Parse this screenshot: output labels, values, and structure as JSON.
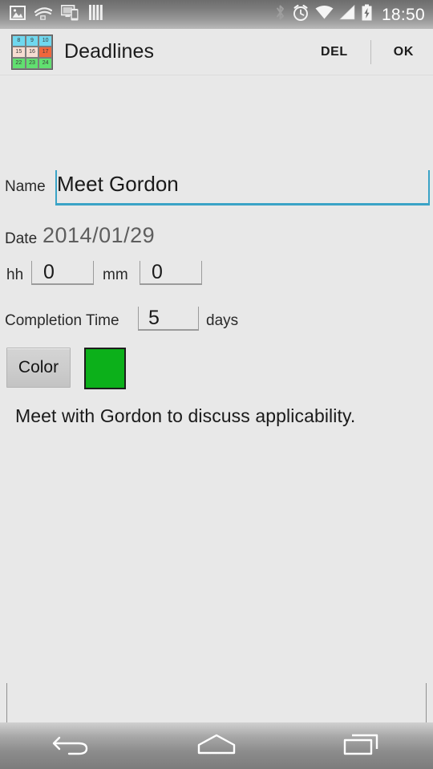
{
  "statusbar": {
    "left_icons": [
      {
        "name": "photo-icon",
        "label": "image"
      },
      {
        "name": "audiobook-icon",
        "label": "audible"
      },
      {
        "name": "screen-cast-icon",
        "label": "cast"
      },
      {
        "name": "bars-icon",
        "label": "bars"
      }
    ],
    "right_icons": [
      {
        "name": "bluetooth-icon",
        "label": "bluetooth"
      },
      {
        "name": "alarm-icon",
        "label": "alarm"
      },
      {
        "name": "wifi-icon",
        "label": "wifi"
      },
      {
        "name": "signal-icon",
        "label": "signal"
      },
      {
        "name": "battery-charging-icon",
        "label": "battery"
      }
    ],
    "clock": "18:50"
  },
  "actionbar": {
    "title": "Deadlines",
    "icon_name": "calendar-grid-icon",
    "icon_cells": [
      {
        "num": "8",
        "bg": "#6fd8ef"
      },
      {
        "num": "9",
        "bg": "#6fd8ef"
      },
      {
        "num": "10",
        "bg": "#6fd8ef"
      },
      {
        "num": "15",
        "bg": "#f7ddd2"
      },
      {
        "num": "16",
        "bg": "#f7ddd2"
      },
      {
        "num": "17",
        "bg": "#f0663c"
      },
      {
        "num": "22",
        "bg": "#61e070"
      },
      {
        "num": "23",
        "bg": "#61e070"
      },
      {
        "num": "24",
        "bg": "#61e070"
      }
    ],
    "delete_label": "DEL",
    "ok_label": "OK"
  },
  "form": {
    "name_label": "Name",
    "name_value": "Meet Gordon",
    "name_placeholder": "",
    "name_underline_color": "#3aa3c6",
    "date_label": "Date",
    "date_value": "2014/01/29",
    "hour_label": "hh",
    "hour_value": "0",
    "minute_label": "mm",
    "minute_value": "0",
    "completion_label": "Completion Time",
    "completion_value": "5",
    "days_label": "days",
    "color_button_label": "Color",
    "color_swatch": "#0cb01a",
    "description": "Meet with Gordon to discuss applicability.",
    "notes_value": "",
    "notes_placeholder": ""
  },
  "navbar": {
    "back_label": "Back",
    "home_label": "Home",
    "recents_label": "Recent apps"
  }
}
